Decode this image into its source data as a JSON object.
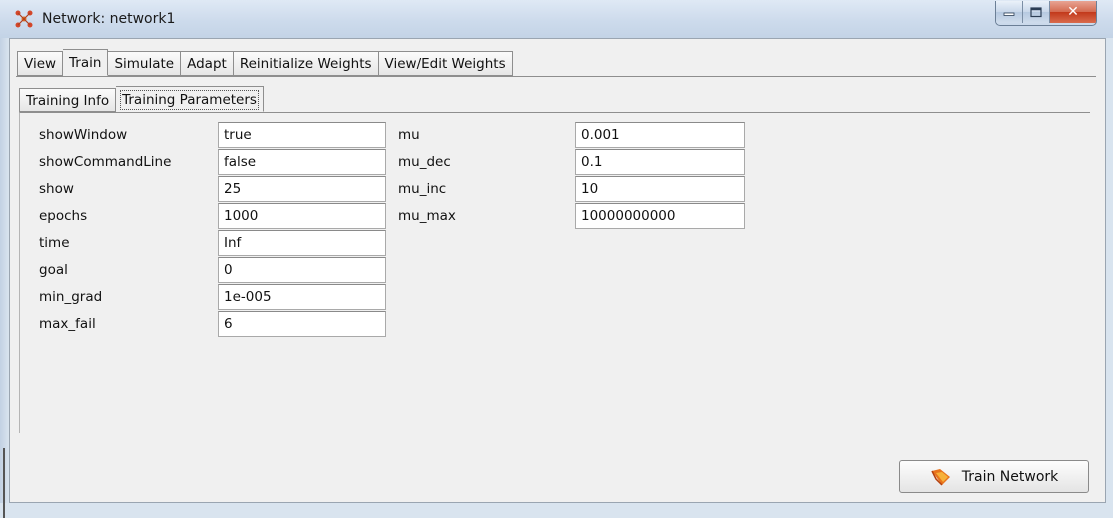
{
  "window": {
    "title": "Network: network1",
    "minimize_glyph": "▁",
    "maximize_glyph": "▢",
    "close_glyph": "✕"
  },
  "tabs": [
    {
      "label": "View",
      "active": false
    },
    {
      "label": "Train",
      "active": true
    },
    {
      "label": "Simulate",
      "active": false
    },
    {
      "label": "Adapt",
      "active": false
    },
    {
      "label": "Reinitialize Weights",
      "active": false
    },
    {
      "label": "View/Edit Weights",
      "active": false
    }
  ],
  "subtabs": [
    {
      "label": "Training Info",
      "active": false
    },
    {
      "label": "Training Parameters",
      "active": true
    }
  ],
  "params_left": [
    {
      "label": "showWindow",
      "value": "true"
    },
    {
      "label": "showCommandLine",
      "value": "false"
    },
    {
      "label": "show",
      "value": "25"
    },
    {
      "label": "epochs",
      "value": "1000"
    },
    {
      "label": "time",
      "value": "Inf"
    },
    {
      "label": "goal",
      "value": "0"
    },
    {
      "label": "min_grad",
      "value": "1e-005"
    },
    {
      "label": "max_fail",
      "value": "6"
    }
  ],
  "params_right": [
    {
      "label": "mu",
      "value": "0.001"
    },
    {
      "label": "mu_dec",
      "value": "0.1"
    },
    {
      "label": "mu_inc",
      "value": "10"
    },
    {
      "label": "mu_max",
      "value": "10000000000"
    }
  ],
  "actions": {
    "train_label": "Train Network",
    "train_icon": "train-flame-icon"
  },
  "colors": {
    "accent_orange": "#e8731c",
    "close_red": "#c2391b"
  }
}
